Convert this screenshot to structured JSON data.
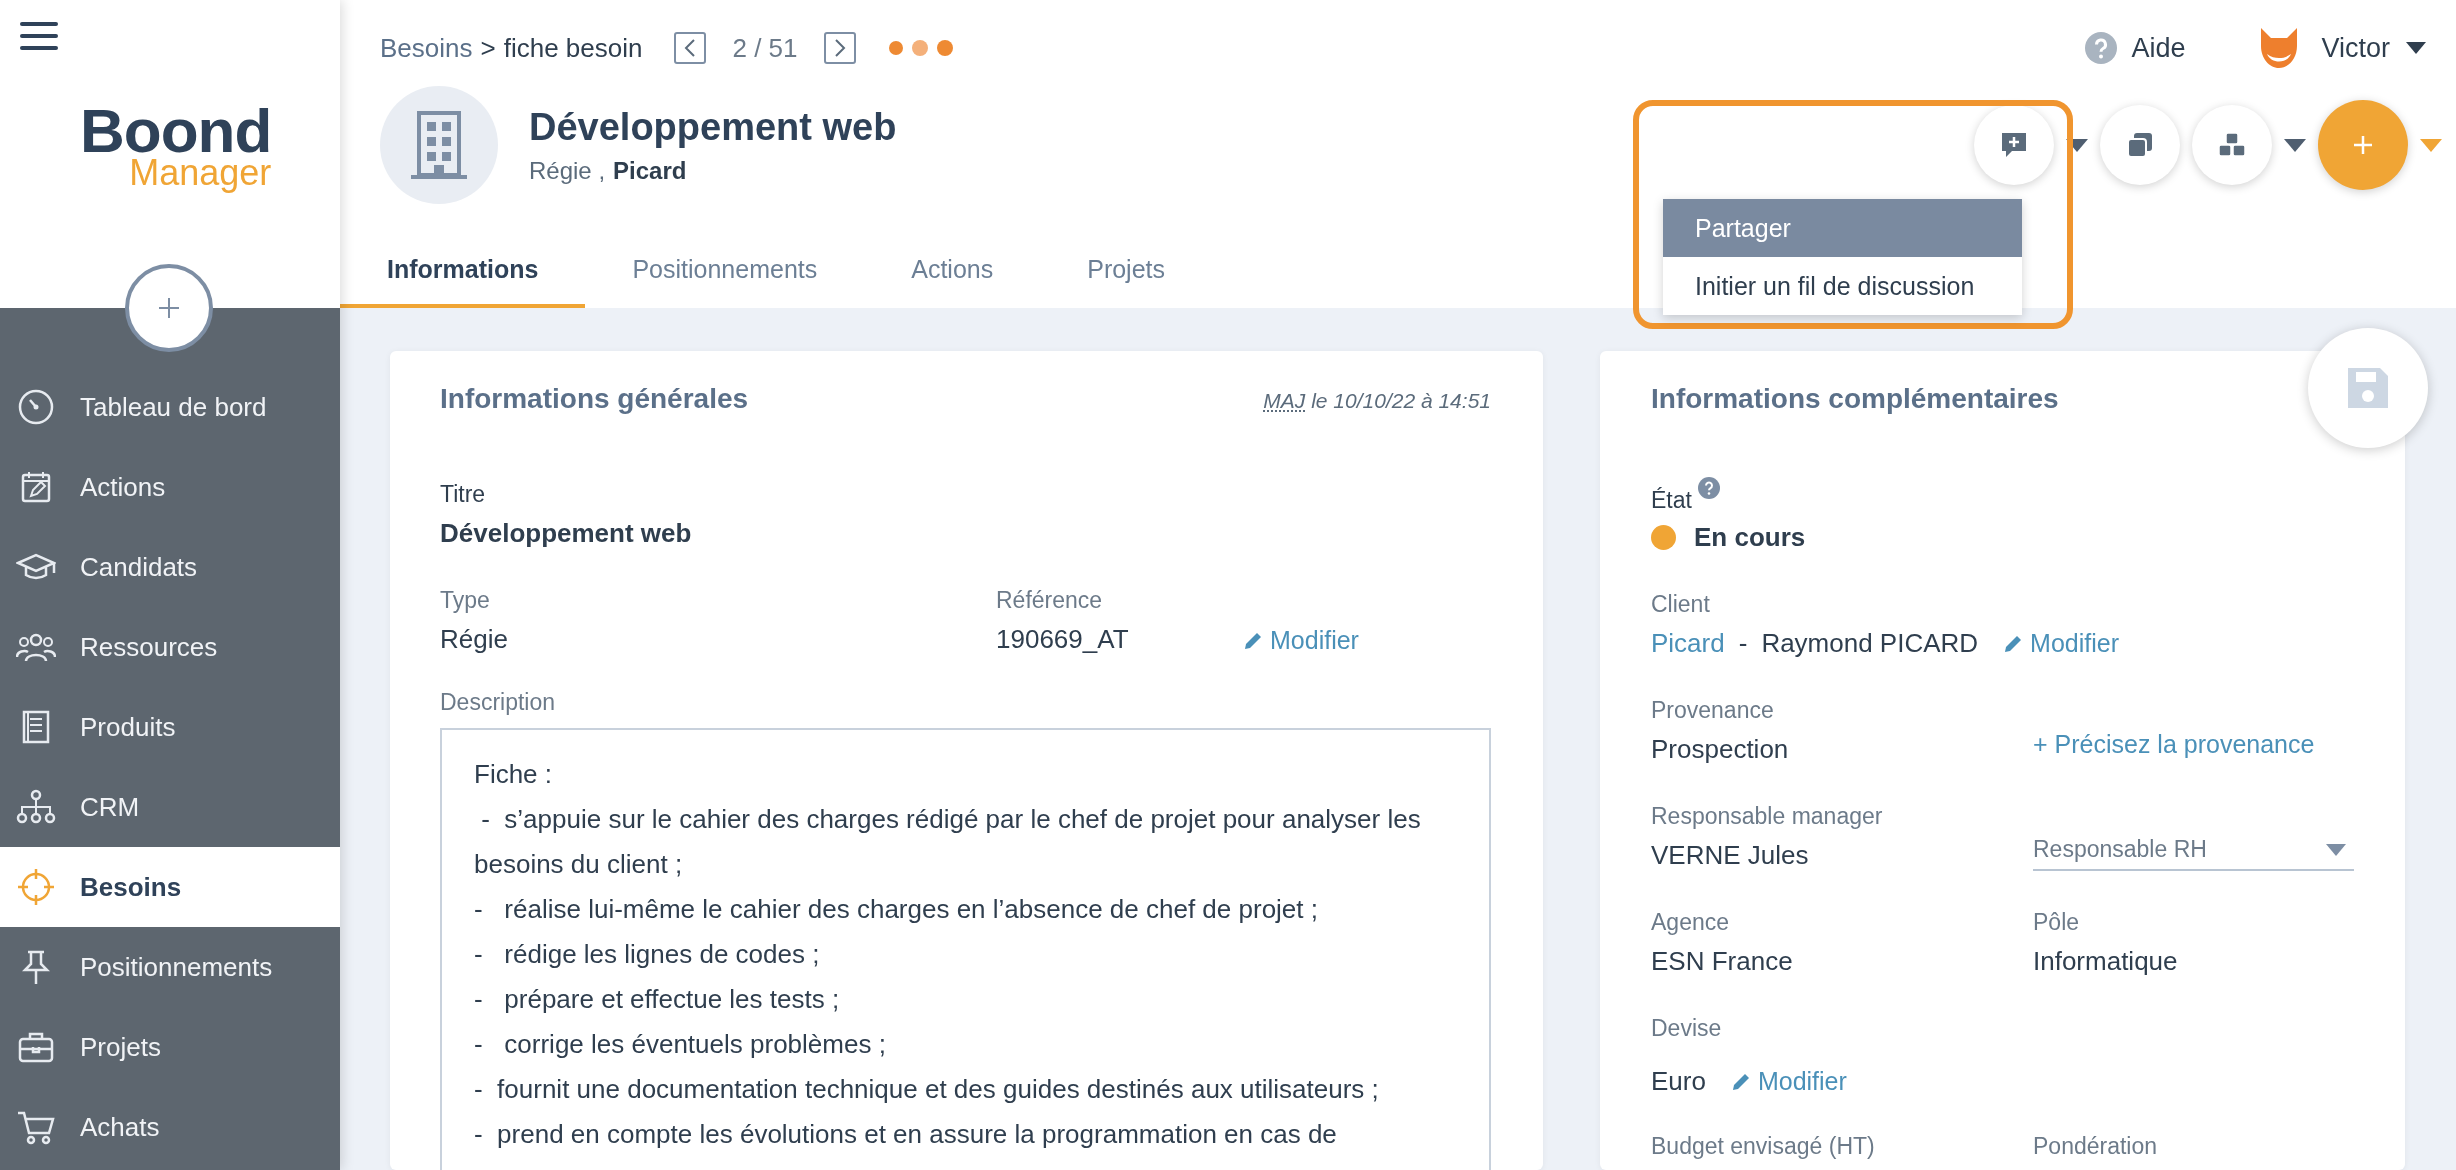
{
  "sidebar": {
    "logo": {
      "title": "Boond",
      "subtitle": "Manager"
    },
    "items": [
      {
        "label": "Tableau de bord",
        "selected": false
      },
      {
        "label": "Actions",
        "selected": false
      },
      {
        "label": "Candidats",
        "selected": false
      },
      {
        "label": "Ressources",
        "selected": false
      },
      {
        "label": "Produits",
        "selected": false
      },
      {
        "label": "CRM",
        "selected": false
      },
      {
        "label": "Besoins",
        "selected": true
      },
      {
        "label": "Positionnements",
        "selected": false
      },
      {
        "label": "Projets",
        "selected": false
      },
      {
        "label": "Achats",
        "selected": false
      }
    ]
  },
  "breadcrumb": {
    "section": "Besoins",
    "separator": ">",
    "page": "fiche besoin"
  },
  "pager": {
    "position": "2 / 51"
  },
  "user": {
    "help": "Aide",
    "name": "Victor"
  },
  "record": {
    "title": "Développement web",
    "type": "Régie ,",
    "client": "Picard"
  },
  "tabs": [
    {
      "label": "Informations",
      "selected": true
    },
    {
      "label": "Positionnements",
      "selected": false
    },
    {
      "label": "Actions",
      "selected": false
    },
    {
      "label": "Projets",
      "selected": false
    }
  ],
  "action_menu": {
    "items": [
      {
        "label": "Partager",
        "selected": true
      },
      {
        "label": "Initier un fil de discussion",
        "selected": false
      }
    ]
  },
  "general": {
    "title": "Informations générales",
    "updated_abbr": "MAJ",
    "updated": "le 10/10/22 à 14:51",
    "title_field": {
      "label": "Titre",
      "value": "Développement web"
    },
    "type": {
      "label": "Type",
      "value": "Régie"
    },
    "reference": {
      "label": "Référence",
      "value": "190669_AT",
      "edit": "Modifier"
    },
    "description": {
      "label": "Description",
      "lines": [
        "Fiche :",
        " -  s’appuie sur le cahier des charges rédigé par le chef de projet pour analyser les besoins du client ;",
        "-   réalise lui-même le cahier des charges en l’absence de chef de projet ;",
        "-   rédige les lignes de codes ;",
        "-   prépare et effectue les tests ;",
        "-   corrige les éventuels problèmes ;",
        "-  fournit une documentation technique et des guides destinés aux utilisateurs ;",
        "-  prend en compte les évolutions et en assure la programmation en cas de"
      ]
    }
  },
  "extra": {
    "title": "Informations complémentaires",
    "state": {
      "label": "État",
      "value": "En cours",
      "color": "#f0a535"
    },
    "client": {
      "label": "Client",
      "company": "Picard",
      "separator": "-",
      "contact": "Raymond PICARD",
      "edit": "Modifier"
    },
    "origin": {
      "label": "Provenance",
      "value": "Prospection",
      "add": "+ Précisez la provenance"
    },
    "manager": {
      "label": "Responsable manager",
      "value": "VERNE Jules"
    },
    "hr_select": {
      "placeholder": "Responsable RH"
    },
    "agency": {
      "label": "Agence",
      "value": "ESN France"
    },
    "pole": {
      "label": "Pôle",
      "value": "Informatique"
    },
    "currency": {
      "label": "Devise",
      "value": "Euro",
      "edit": "Modifier"
    },
    "budget": {
      "label": "Budget envisagé (HT)"
    },
    "weighting": {
      "label": "Pondération"
    }
  }
}
